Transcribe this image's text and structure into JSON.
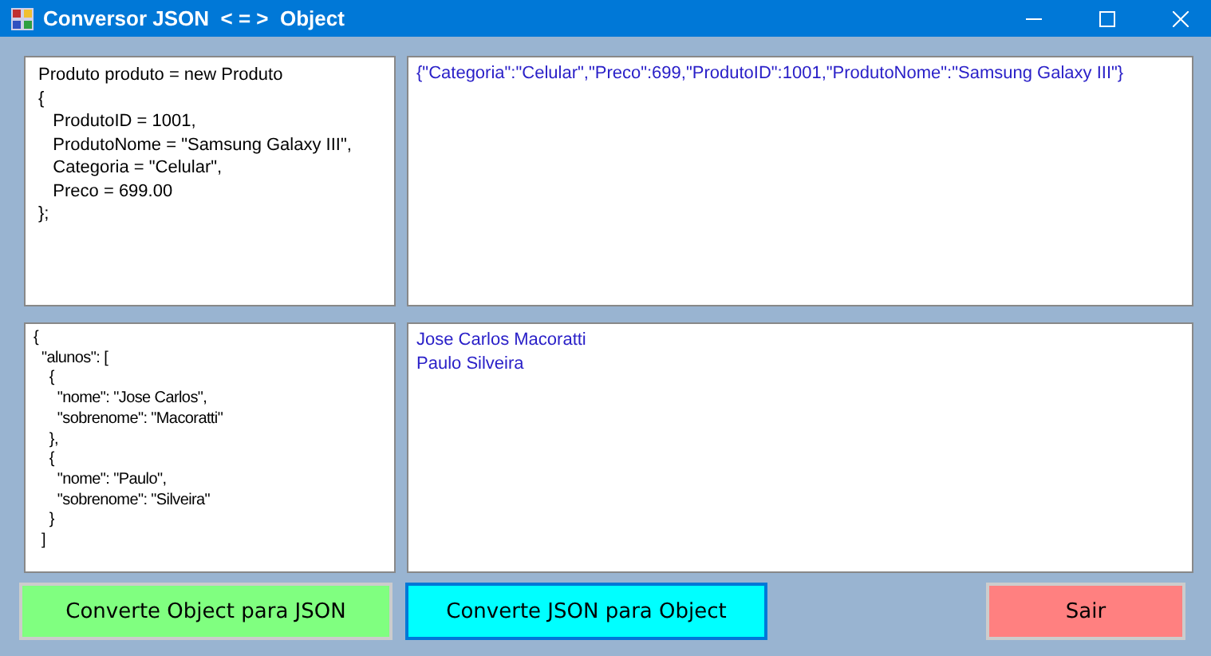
{
  "window": {
    "title": "Conversor JSON  < = >  Object"
  },
  "object_code": {
    "lines": [
      "Produto produto = new Produto",
      "{",
      "   ProdutoID = 1001,",
      "   ProdutoNome = \"Samsung Galaxy III\",",
      "   Categoria = \"Celular\",",
      "   Preco = 699.00",
      "};"
    ]
  },
  "json_output": {
    "lines": [
      "{\"Categoria\":\"Celular\",\"Preco\":699,\"ProdutoID\":1001,\"ProdutoNome\":\"Samsung Galaxy III\"}"
    ]
  },
  "json_input": {
    "lines": [
      "{",
      "  \"alunos\": [",
      "    {",
      "      \"nome\": \"Jose Carlos\",",
      "      \"sobrenome\": \"Macoratti\"",
      "    },",
      "    {",
      "      \"nome\": \"Paulo\",",
      "      \"sobrenome\": \"Silveira\"",
      "    }",
      "  ]"
    ]
  },
  "object_output": {
    "lines": [
      "Jose Carlos Macoratti",
      "Paulo Silveira"
    ]
  },
  "buttons": [
    {
      "label": "Converte Object para JSON",
      "kind": "green",
      "selected": false
    },
    {
      "label": "Converte JSON para Object",
      "kind": "cyan",
      "selected": true
    },
    {
      "label": "Sair",
      "kind": "red",
      "selected": false
    }
  ]
}
